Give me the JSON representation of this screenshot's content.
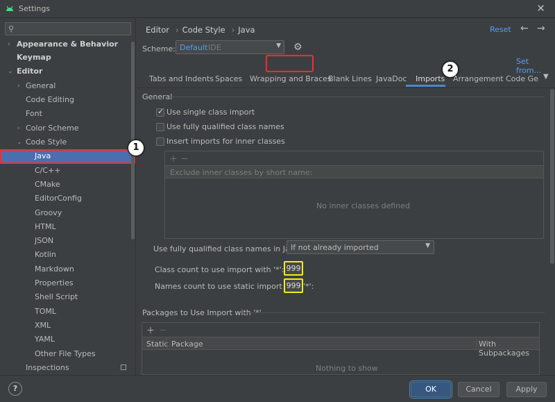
{
  "window": {
    "title": "Settings"
  },
  "sidebar": {
    "search_placeholder": "",
    "items": [
      {
        "label": "Appearance & Behavior"
      },
      {
        "label": "Keymap"
      },
      {
        "label": "Editor"
      },
      {
        "label": "General"
      },
      {
        "label": "Code Editing"
      },
      {
        "label": "Font"
      },
      {
        "label": "Color Scheme"
      },
      {
        "label": "Code Style"
      },
      {
        "label": "Java"
      },
      {
        "label": "C/C++"
      },
      {
        "label": "CMake"
      },
      {
        "label": "EditorConfig"
      },
      {
        "label": "Groovy"
      },
      {
        "label": "HTML"
      },
      {
        "label": "JSON"
      },
      {
        "label": "Kotlin"
      },
      {
        "label": "Markdown"
      },
      {
        "label": "Properties"
      },
      {
        "label": "Shell Script"
      },
      {
        "label": "TOML"
      },
      {
        "label": "XML"
      },
      {
        "label": "YAML"
      },
      {
        "label": "Other File Types"
      },
      {
        "label": "Inspections"
      }
    ]
  },
  "badges": {
    "one": "1",
    "two": "2"
  },
  "header": {
    "breadcrumb": [
      "Editor",
      "Code Style",
      "Java"
    ],
    "reset": "Reset",
    "scheme_label": "Scheme:",
    "scheme_value": "Default",
    "scheme_scope": "IDE",
    "set_from": "Set from..."
  },
  "tabs": [
    {
      "label": "Tabs and Indents"
    },
    {
      "label": "Spaces"
    },
    {
      "label": "Wrapping and Braces"
    },
    {
      "label": "Blank Lines"
    },
    {
      "label": "JavaDoc"
    },
    {
      "label": "Imports"
    },
    {
      "label": "Arrangement"
    },
    {
      "label": "Code Ge"
    }
  ],
  "general": {
    "title": "General",
    "options": [
      {
        "label": "Use single class import",
        "checked": true
      },
      {
        "label": "Use fully qualified class names",
        "checked": false
      },
      {
        "label": "Insert imports for inner classes",
        "checked": false
      }
    ],
    "inner_header": "Exclude inner classes by short name:",
    "inner_empty": "No inner classes defined",
    "javadoc_label": "Use fully qualified class names in JavaDoc:",
    "javadoc_value": "If not already imported",
    "class_count_label": "Class count to use import with '*':",
    "class_count_value": "999",
    "names_count_label": "Names count to use static import with '*':",
    "names_count_value": "999"
  },
  "packages": {
    "title": "Packages to Use Import with '*'",
    "col_static": "Static",
    "col_package": "Package",
    "col_sub": "With Subpackages",
    "empty": "Nothing to show"
  },
  "footer": {
    "help": "?",
    "ok": "OK",
    "cancel": "Cancel",
    "apply": "Apply"
  },
  "colors": {
    "accent": "#589df6",
    "selection": "#4b6eaf",
    "highlight_red": "#ff2a2a",
    "highlight_yellow": "#f2ef16"
  }
}
